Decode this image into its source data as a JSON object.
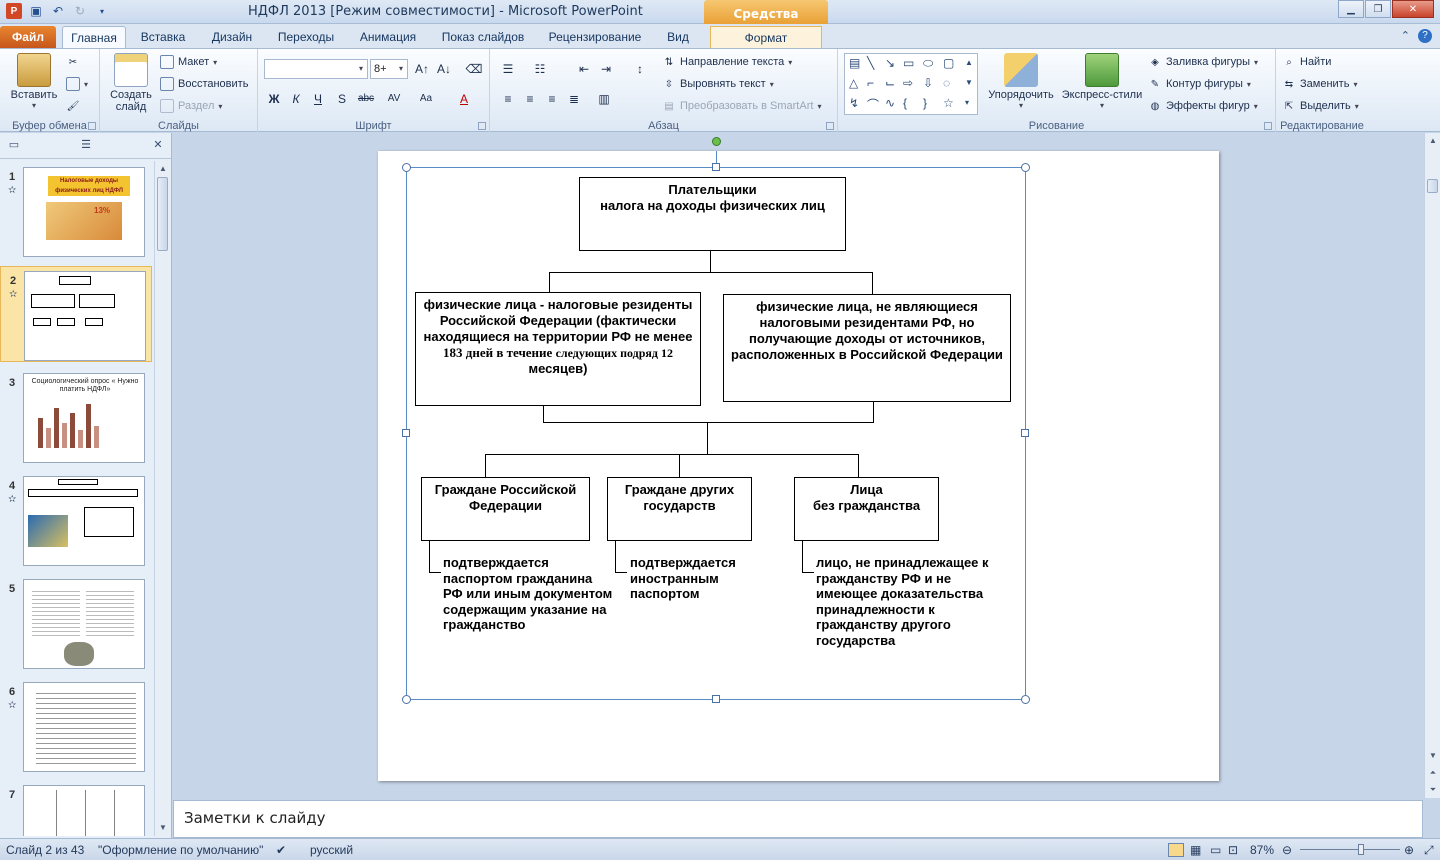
{
  "window": {
    "title": "НДФЛ 2013 [Режим совместимости]  -  Microsoft PowerPoint",
    "context_tab_title": "Средства рисования",
    "controls": [
      "minimize",
      "maximize",
      "close"
    ]
  },
  "tabs": [
    {
      "label": "Файл"
    },
    {
      "label": "Главная"
    },
    {
      "label": "Вставка"
    },
    {
      "label": "Дизайн"
    },
    {
      "label": "Переходы"
    },
    {
      "label": "Анимация"
    },
    {
      "label": "Показ слайдов"
    },
    {
      "label": "Рецензирование"
    },
    {
      "label": "Вид"
    },
    {
      "label": "Формат"
    }
  ],
  "ribbon": {
    "clipboard": {
      "paste": "Вставить",
      "group": "Буфер обмена"
    },
    "slides": {
      "new_slide": "Создать слайд",
      "layout": "Макет",
      "reset": "Восстановить",
      "section": "Раздел",
      "group": "Слайды"
    },
    "font": {
      "font_name": "",
      "font_size": "8+",
      "group": "Шрифт"
    },
    "paragraph": {
      "text_direction": "Направление текста",
      "align_text": "Выровнять текст",
      "smartart": "Преобразовать в SmartArt",
      "group": "Абзац"
    },
    "drawing": {
      "arrange": "Упорядочить",
      "quick_styles": "Экспресс-стили",
      "shape_fill": "Заливка фигуры",
      "shape_outline": "Контур фигуры",
      "shape_effects": "Эффекты фигур",
      "group": "Рисование"
    },
    "editing": {
      "find": "Найти",
      "replace": "Заменить",
      "select": "Выделить",
      "group": "Редактирование"
    }
  },
  "slides_panel": {
    "numbers": [
      "1",
      "2",
      "3",
      "4",
      "5",
      "6",
      "7"
    ],
    "selected": "2",
    "thumb1_title": "Налоговые доходы физических лиц НДФЛ",
    "thumb1_rate": "13%",
    "thumb3_title": "Социологический опрос « Нужно платить НДФЛ»"
  },
  "slide": {
    "root": {
      "line1": "Плательщики",
      "line2": "налога на доходы физических лиц"
    },
    "residents": {
      "text_a": "физические лица - налоговые резиденты Российской Федерации (фактически находящиеся на территории РФ не менее ",
      "text_b": "183 дней в течение ",
      "text_c": "следующих подряд  12",
      "text_d": " месяцев)"
    },
    "nonresidents": "физические лица, не являющиеся налоговыми резидентами РФ, но получающие доходы от источников, расположенных в Российской Федерации",
    "citizens_rf": "Граждане Российской Федерации",
    "citizens_other": {
      "line1": "Граждане других",
      "line2": "государств"
    },
    "stateless": {
      "line1": "Лица",
      "line2": "без гражданства"
    },
    "note_rf": "подтверждается паспортом гражданина РФ или иным документом содержащим указание на гражданство",
    "note_other": "подтверждается иностранным паспортом",
    "note_stateless": "лицо, не принадлежащее к гражданству РФ и не имеющее доказательства принадлежности к гражданству другого государства"
  },
  "notes": {
    "placeholder": "Заметки к слайду"
  },
  "status": {
    "slide_info": "Слайд 2 из 43",
    "theme": "\"Оформление по умолчанию\"",
    "language": "русский",
    "zoom": "87%",
    "zoom_fraction": 0.62
  },
  "colors": {
    "accent_file_tab": "#d4691f",
    "context_tab": "#f0a33a",
    "selection": "#5b8bc6"
  }
}
